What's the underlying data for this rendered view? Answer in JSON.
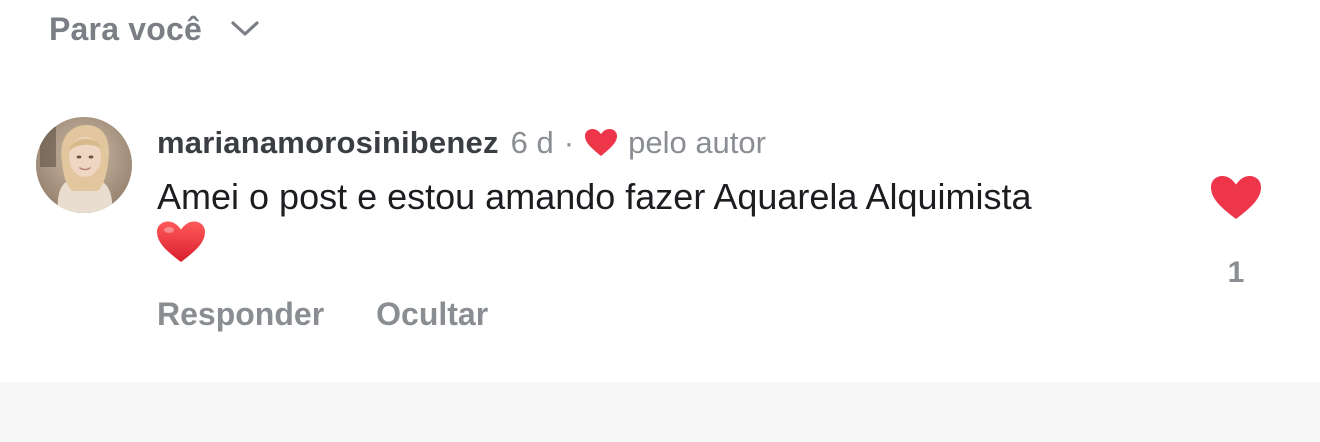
{
  "filter": {
    "label": "Para você",
    "icon": "chevron-down-icon"
  },
  "comment": {
    "username": "marianamorosinibenez",
    "time": "6 d",
    "separator": "·",
    "liked_by_author": "pelo autor",
    "text": "Amei o post e estou amando fazer Aquarela Alquimista",
    "text_emoji": "heart-emoji",
    "actions": {
      "reply": "Responder",
      "hide": "Ocultar"
    },
    "like_count": "1",
    "liked": true
  },
  "colors": {
    "heart_red": "#ed3649",
    "muted_text": "#8a8e93",
    "body_text": "#1c1d20"
  }
}
